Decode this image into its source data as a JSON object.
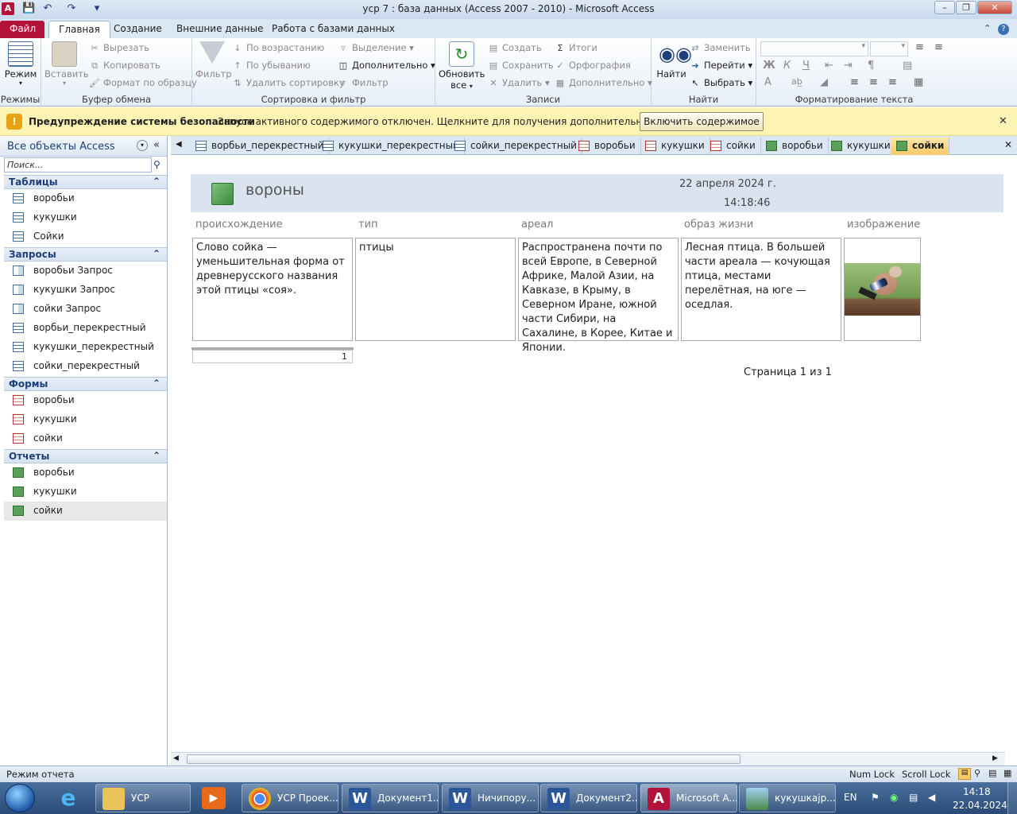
{
  "window": {
    "title": "уср 7 : база данных (Access 2007 - 2010)  -  Microsoft Access"
  },
  "ribbon_tabs": [
    "Файл",
    "Главная",
    "Создание",
    "Внешние данные",
    "Работа с базами данных"
  ],
  "ribbon": {
    "views": {
      "mode": "Режим",
      "group": "Режимы"
    },
    "clipboard": {
      "paste": "Вставить",
      "cut": "Вырезать",
      "copy": "Копировать",
      "format_painter": "Формат по образцу",
      "group": "Буфер обмена"
    },
    "sort_filter": {
      "filter": "Фильтр",
      "ascending": "По возрастанию",
      "descending": "По убыванию",
      "remove_sort": "Удалить сортировку",
      "selection": "Выделение",
      "advanced": "Дополнительно",
      "toggle_filter": "Фильтр",
      "group": "Сортировка и фильтр"
    },
    "records": {
      "refresh": "Обновить",
      "refresh2": "все",
      "new": "Создать",
      "save": "Сохранить",
      "delete": "Удалить",
      "totals": "Итоги",
      "spelling": "Орфография",
      "more": "Дополнительно",
      "group": "Записи"
    },
    "find": {
      "find": "Найти",
      "replace": "Заменить",
      "goto": "Перейти",
      "select": "Выбрать",
      "group": "Найти"
    },
    "text_format": {
      "bold": "Ж",
      "italic": "К",
      "underline": "Ч",
      "font_color": "A",
      "group": "Форматирование текста"
    }
  },
  "security_bar": {
    "title": "Предупреждение системы безопасности",
    "message": "Запуск активного содержимого отключен. Щелкните для получения дополнительных сведений.",
    "button": "Включить содержимое"
  },
  "nav": {
    "header": "Все объекты Access",
    "search_placeholder": "Поиск...",
    "sections": [
      {
        "title": "Таблицы",
        "items": [
          "воробьи",
          "кукушки",
          "Сойки"
        ]
      },
      {
        "title": "Запросы",
        "items": [
          "воробьи Запрос",
          "кукушки Запрос",
          "сойки Запрос",
          "ворбьи_перекрестный",
          "кукушки_перекрестный",
          "сойки_перекрестный"
        ]
      },
      {
        "title": "Формы",
        "items": [
          "воробьи",
          "кукушки",
          "сойки"
        ]
      },
      {
        "title": "Отчеты",
        "items": [
          "воробьи",
          "кукушки",
          "сойки"
        ]
      }
    ]
  },
  "doc_tabs": [
    "ворбьи_перекрестный",
    "кукушки_перекрестный",
    "сойки_перекрестный",
    "воробьи",
    "кукушки",
    "сойки",
    "воробьи",
    "кукушки",
    "сойки"
  ],
  "report": {
    "title": "вороны",
    "date": "22 апреля 2024 г.",
    "time": "14:18:46",
    "columns": [
      "происхождение",
      "тип",
      "ареал",
      "образ жизни",
      "изображение"
    ],
    "row": {
      "origin": "Слово сойка — уменьшительная форма от древнерусского названия этой птицы «соя».",
      "type": "птицы",
      "range": "Распространена почти по всей Европе, в Северной Африке, Малой Азии, на Кавказе, в Крыму, в Северном  Иране, южной части Сибири, на Сахалине, в Корее, Китае и Японии.",
      "lifestyle": "Лесная птица. В большей части ареала — кочующая птица, местами перелётная, на юге — оседлая."
    },
    "count": "1",
    "page": "Страница 1 из 1"
  },
  "status": {
    "mode": "Режим отчета",
    "numlock": "Num Lock",
    "scrolllock": "Scroll Lock"
  },
  "taskbar": {
    "items": [
      "УСР",
      "УСР Проек...",
      "Документ1...",
      "Ничипору...",
      "Документ2...",
      "Microsoft A...",
      "кукушкаjp..."
    ],
    "lang": "EN",
    "time": "14:18",
    "date": "22.04.2024"
  }
}
